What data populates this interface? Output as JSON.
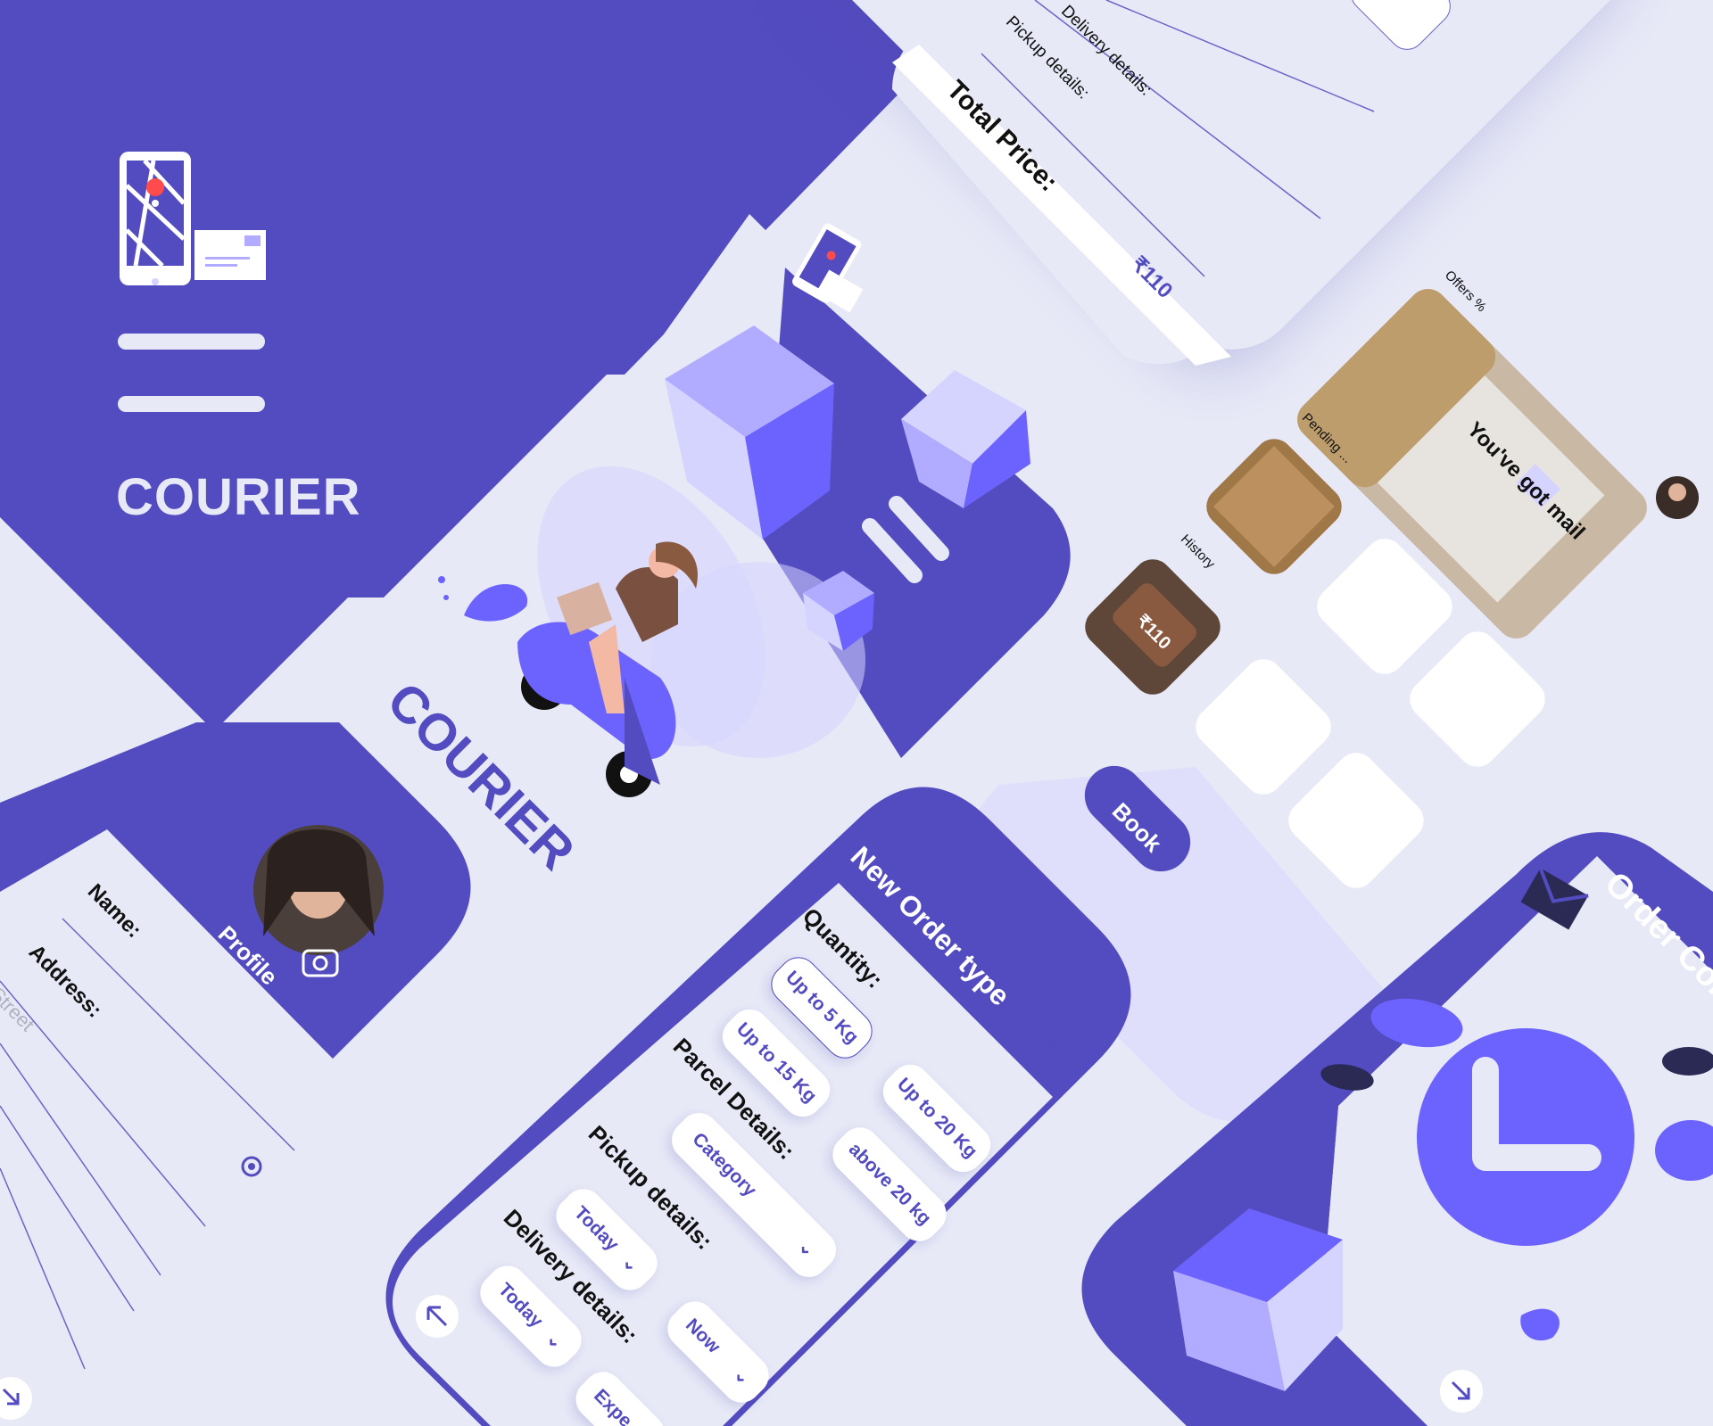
{
  "brand": {
    "name": "COURIER",
    "colors": {
      "primary": "#534bc0",
      "accent": "#6c63ff",
      "light": "#e7e9f7",
      "box_light": "#b1acff",
      "box_pale": "#d5d3ff"
    }
  },
  "splash": {
    "title": "COURIER"
  },
  "summary": {
    "delivery_details_label": "Delivery details:",
    "pickup_details_label": "Pickup details:",
    "total_price_label": "Total  Price:",
    "price": "₹110"
  },
  "dashboard": {
    "offers_label": "Offers %",
    "offer_image_text": "You've got mail",
    "pending_label": "Pending ...",
    "history_label": "History",
    "history_price": "₹110",
    "book_button": "Book"
  },
  "profile": {
    "title": "Profile",
    "name_label": "Name:",
    "address_label": "Address:",
    "street_placeholder": "Street"
  },
  "new_order": {
    "title": "New Order type",
    "quantity_label": "Quantity:",
    "quantity_options": [
      "Up to 5 Kg",
      "Up to 15 Kg",
      "Up to 20 Kg",
      "above 20 kg"
    ],
    "parcel_label": "Parcel Details:",
    "category_placeholder": "Category",
    "pickup_label": "Pickup details:",
    "pickup_day": "Today",
    "pickup_time": "Now",
    "delivery_label": "Delivery details:",
    "delivery_day": "Today",
    "delivery_speed": "Expe"
  },
  "order_confirm": {
    "title": "Order Con"
  },
  "icons": [
    "phone-map-icon",
    "envelope-icon",
    "camera-icon",
    "location-target-icon",
    "back-arrow-icon",
    "next-arrow-icon",
    "scooter-pin-icon",
    "leaf-icon",
    "clock-icon"
  ]
}
